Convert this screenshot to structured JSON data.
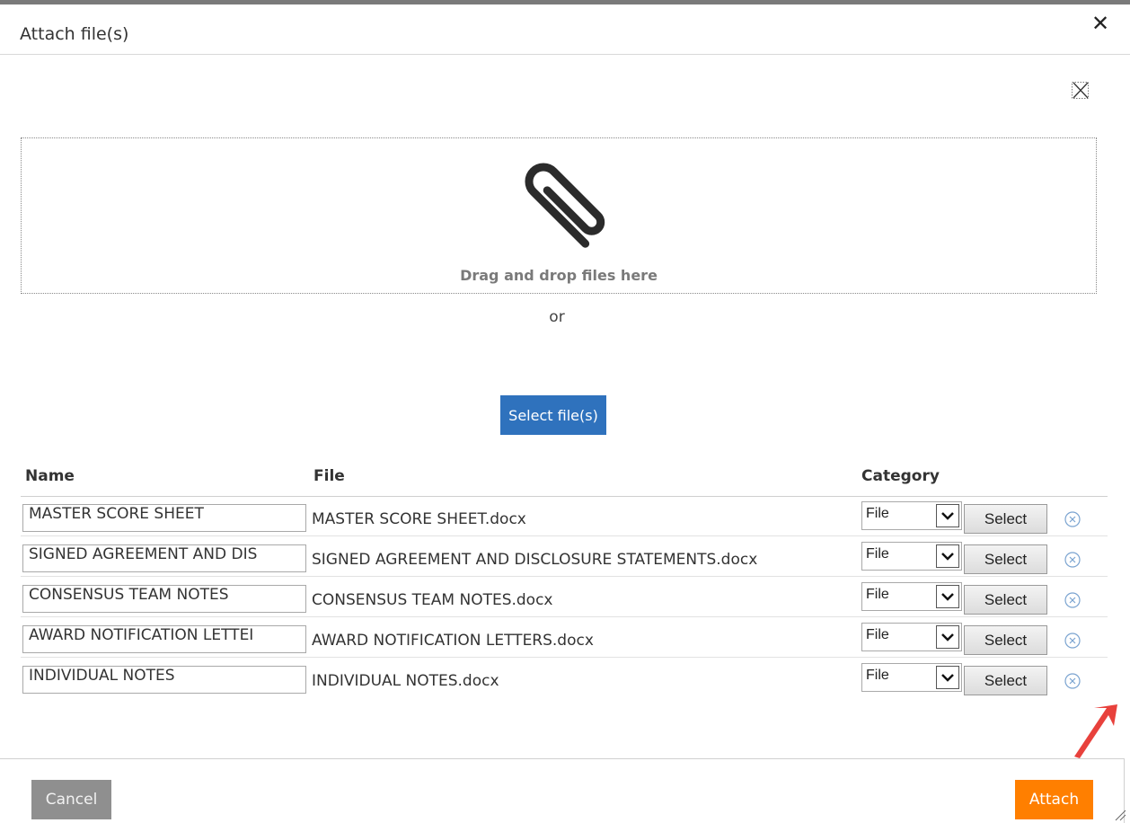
{
  "dialog": {
    "title": "Attach file(s)",
    "close_icon": "close-icon",
    "clear_icon": "clear-all-icon"
  },
  "dropzone": {
    "icon": "paperclip-icon",
    "text": "Drag and drop files here",
    "or_text": "or",
    "select_button": "Select file(s)"
  },
  "table": {
    "headers": {
      "name": "Name",
      "file": "File",
      "category": "Category"
    },
    "rows": [
      {
        "name": "MASTER SCORE SHEET",
        "file": "MASTER SCORE SHEET.docx",
        "category": "File",
        "select_label": "Select"
      },
      {
        "name": "SIGNED AGREEMENT AND DIS",
        "file": "SIGNED AGREEMENT AND DISCLOSURE STATEMENTS.docx",
        "category": "File",
        "select_label": "Select"
      },
      {
        "name": "CONSENSUS TEAM NOTES",
        "file": "CONSENSUS TEAM NOTES.docx",
        "category": "File",
        "select_label": "Select"
      },
      {
        "name": "AWARD NOTIFICATION LETTEI",
        "file": "AWARD NOTIFICATION LETTERS.docx",
        "category": "File",
        "select_label": "Select"
      },
      {
        "name": "INDIVIDUAL NOTES",
        "file": "INDIVIDUAL NOTES.docx",
        "category": "File",
        "select_label": "Select"
      }
    ]
  },
  "footer": {
    "cancel_label": "Cancel",
    "attach_label": "Attach"
  },
  "colors": {
    "primary_blue": "#2f72bd",
    "attach_orange": "#ff7f00",
    "cancel_gray": "#8f8f8f",
    "arrow_red": "#e8413c"
  }
}
